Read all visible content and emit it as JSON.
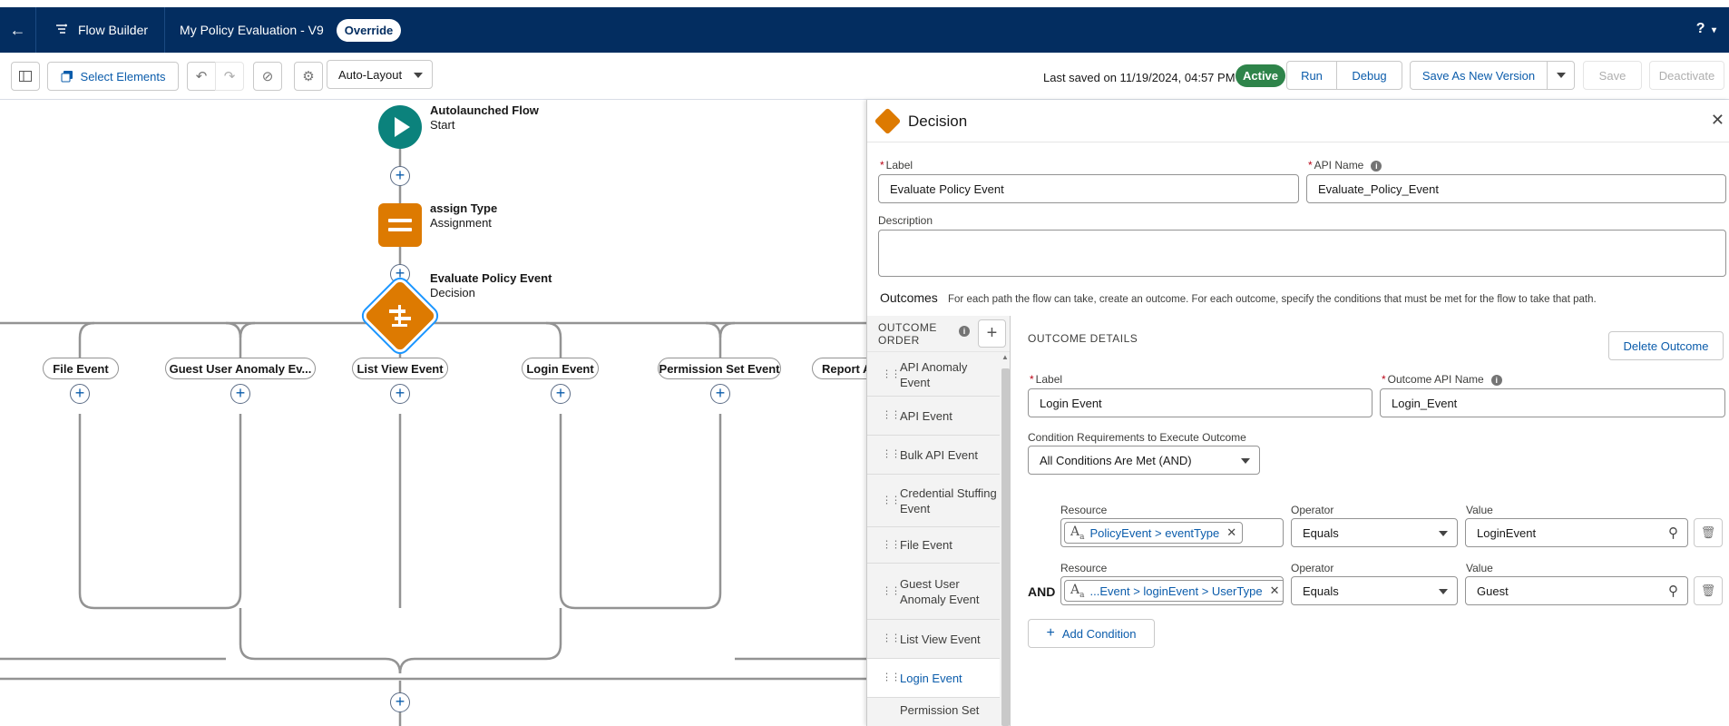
{
  "topbar": {
    "app_name": "Flow Builder",
    "flow_name": "My Policy Evaluation - V9",
    "override_label": "Override",
    "help_label": "?"
  },
  "toolbar": {
    "select_elements_label": "Select Elements",
    "layout_label": "Auto-Layout",
    "last_saved": "Last saved on 11/19/2024, 04:57 PM",
    "status_badge": "Active",
    "run_label": "Run",
    "debug_label": "Debug",
    "save_new_version_label": "Save As New Version",
    "save_label": "Save",
    "deactivate_label": "Deactivate"
  },
  "canvas": {
    "start": {
      "title": "Autolaunched Flow",
      "subtitle": "Start"
    },
    "assignment": {
      "title": "assign Type",
      "subtitle": "Assignment"
    },
    "decision": {
      "title": "Evaluate Policy Event",
      "subtitle": "Decision"
    },
    "branches": [
      "File Event",
      "Guest User Anomaly Ev...",
      "List View Event",
      "Login Event",
      "Permission Set Event",
      "Report A"
    ]
  },
  "panel": {
    "title": "Decision",
    "label_label": "Label",
    "label_value": "Evaluate Policy Event",
    "api_name_label": "API Name",
    "api_name_value": "Evaluate_Policy_Event",
    "description_label": "Description",
    "description_value": "",
    "outcomes_heading": "Outcomes",
    "outcomes_help": "For each path the flow can take, create an outcome. For each outcome, specify the conditions that must be met for the flow to take that path.",
    "outcome_order_label": "OUTCOME ORDER",
    "outcome_order": [
      "API Anomaly Event",
      "API Event",
      "Bulk API Event",
      "Credential Stuffing Event",
      "File Event",
      "Guest User Anomaly Event",
      "List View Event",
      "Login Event",
      "Permission Set"
    ],
    "selected_outcome": "Login Event",
    "outcome_details_label": "OUTCOME DETAILS",
    "delete_outcome_label": "Delete Outcome",
    "outcome_label_label": "Label",
    "outcome_label_value": "Login Event",
    "outcome_api_label": "Outcome API Name",
    "outcome_api_value": "Login_Event",
    "condition_req_label": "Condition Requirements to Execute Outcome",
    "condition_req_value": "All Conditions Are Met (AND)",
    "conditions": [
      {
        "connector": "",
        "resource_label": "Resource",
        "resource": "PolicyEvent > eventType",
        "operator_label": "Operator",
        "operator": "Equals",
        "value_label": "Value",
        "value": "LoginEvent"
      },
      {
        "connector": "AND",
        "resource_label": "Resource",
        "resource": "...Event > loginEvent > UserType",
        "operator_label": "Operator",
        "operator": "Equals",
        "value_label": "Value",
        "value": "Guest"
      }
    ],
    "add_condition_label": "Add Condition"
  },
  "colors": {
    "header_bg": "#032d60",
    "start_node": "#0b827c",
    "assignment_node": "#dd7a01",
    "decision_node": "#dd7a01",
    "active_badge": "#2e844a",
    "link_blue": "#0b5cab"
  }
}
